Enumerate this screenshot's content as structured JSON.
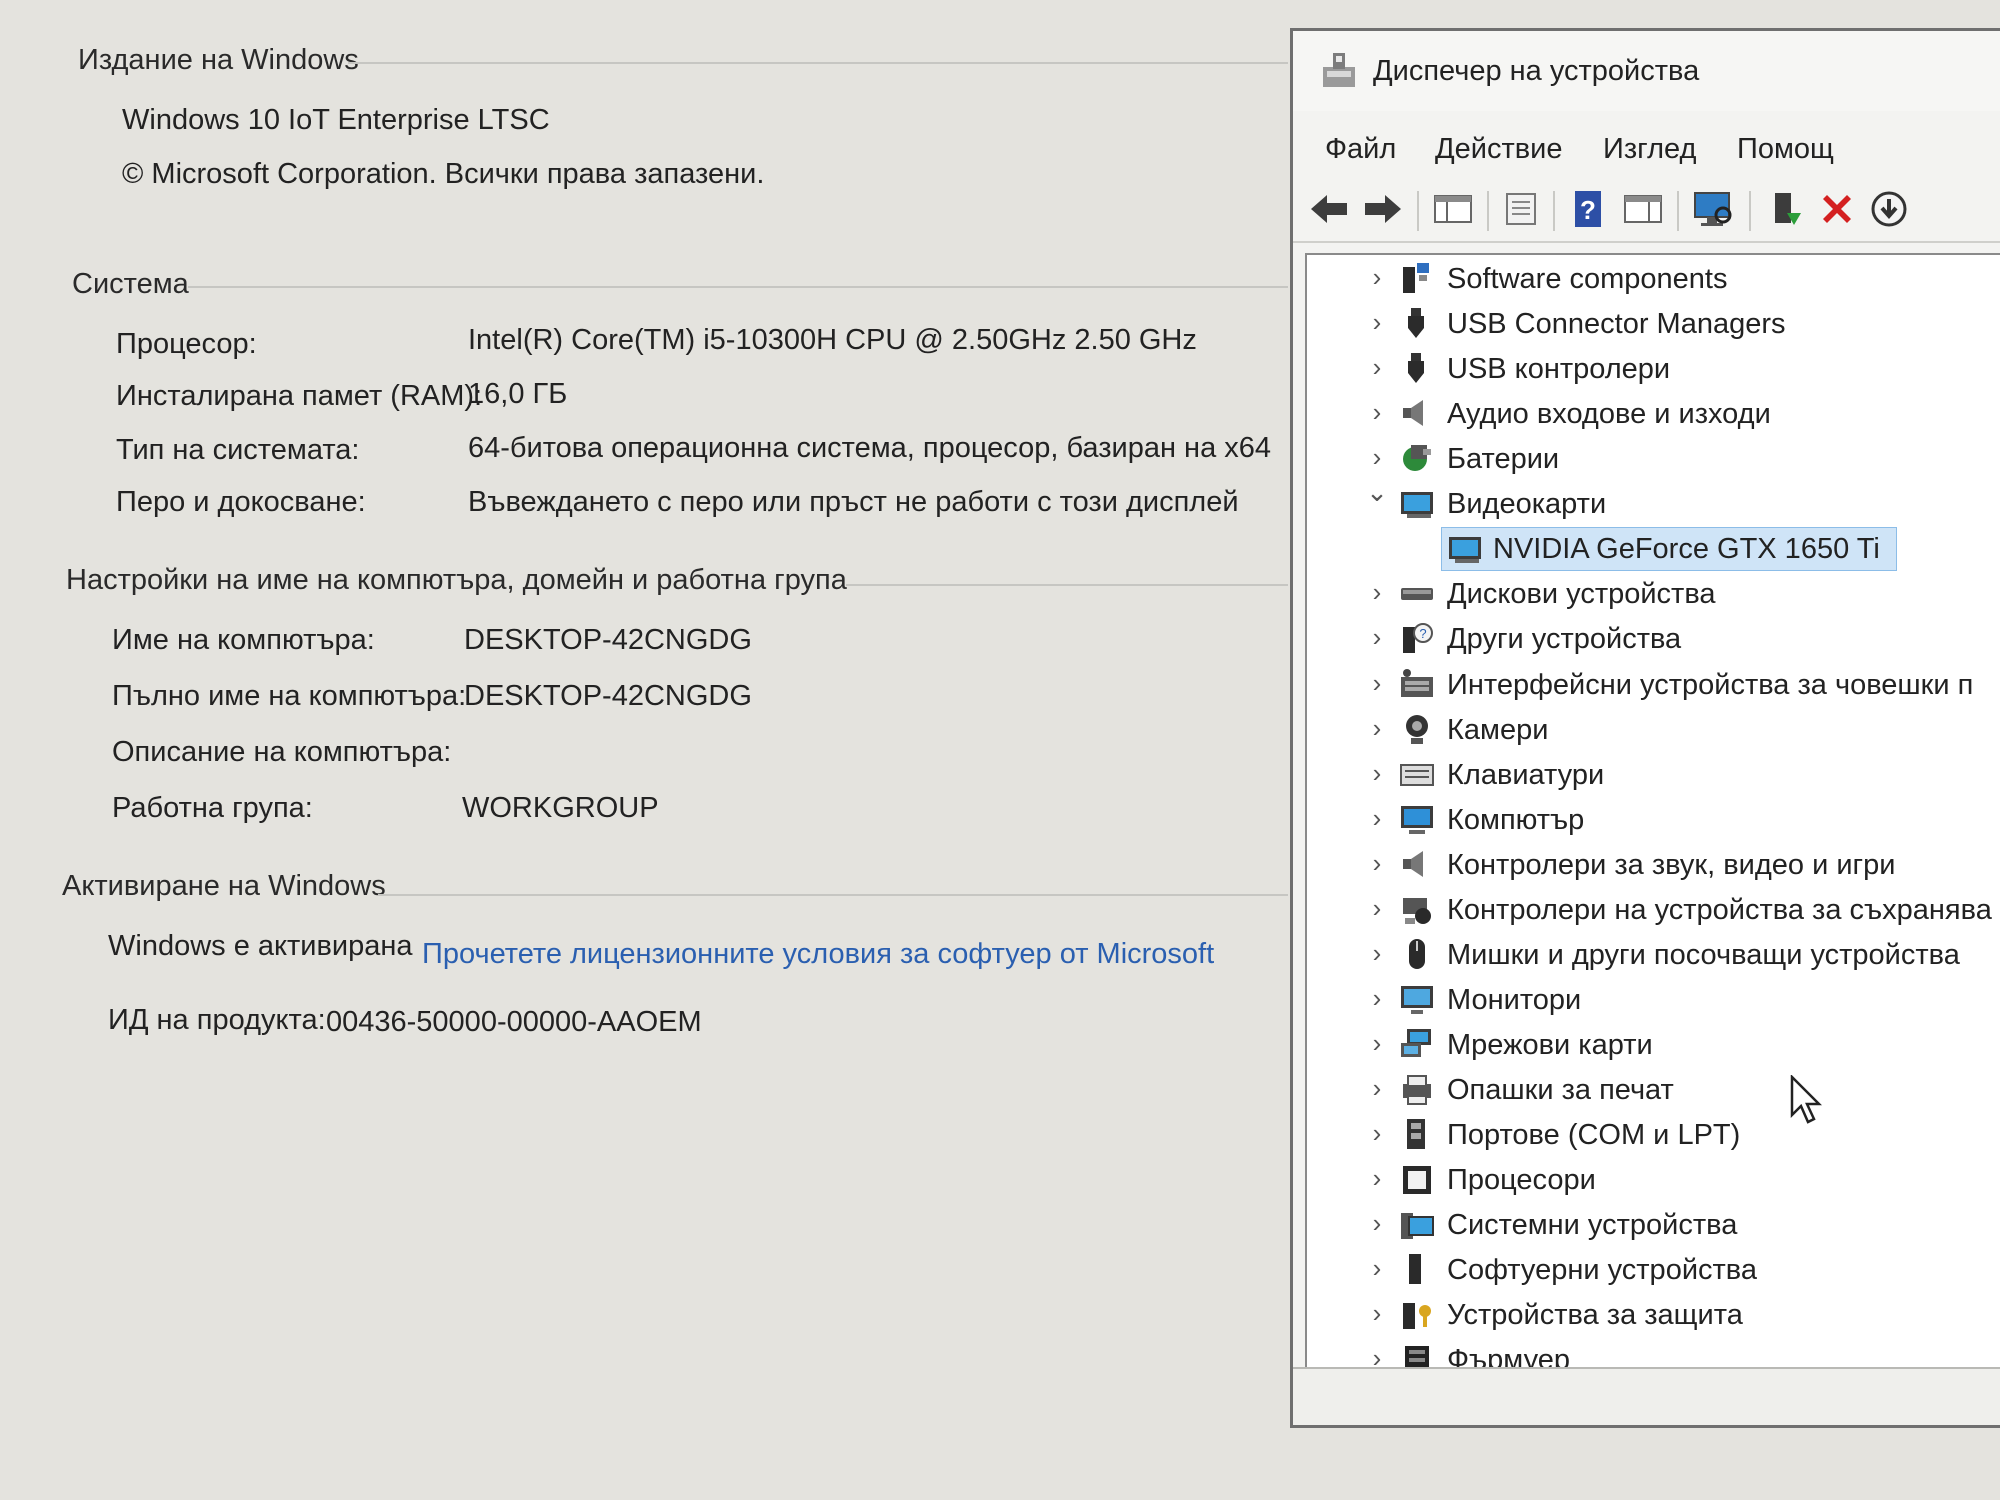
{
  "sysinfo": {
    "edition": {
      "heading": "Издание на Windows",
      "name": "Windows 10 IoT Enterprise LTSC",
      "copyright": "© Microsoft Corporation. Всички права запазени."
    },
    "system": {
      "heading": "Система",
      "rows": [
        {
          "label": "Процесор:",
          "value": "Intel(R) Core(TM) i5-10300H CPU @ 2.50GHz   2.50 GHz"
        },
        {
          "label": "Инсталирана памет (RAM):",
          "value": "16,0 ГБ"
        },
        {
          "label": "Тип на системата:",
          "value": "64-битова операционна система, процесор, базиран на x64"
        },
        {
          "label": "Перо и докосване:",
          "value": "Въвеждането с перо или пръст не работи с този дисплей"
        }
      ]
    },
    "computer": {
      "heading": "Настройки на име на компютъра, домейн и работна група",
      "rows": [
        {
          "label": "Име на компютъра:",
          "value": "DESKTOP-42CNGDG"
        },
        {
          "label": "Пълно име на компютъра:",
          "value": "DESKTOP-42CNGDG"
        },
        {
          "label": "Описание на компютъра:",
          "value": ""
        },
        {
          "label": "Работна група:",
          "value": "WORKGROUP"
        }
      ]
    },
    "activation": {
      "heading": "Активиране на Windows",
      "status": "Windows е активирана",
      "license_link": "Прочетете лицензионните условия за софтуер от Microsoft",
      "product_id_label": "ИД на продукта:",
      "product_id": "00436-50000-00000-AAOEM"
    }
  },
  "devmgr": {
    "title": "Диспечер на устройства",
    "menu": [
      "Файл",
      "Действие",
      "Изглед",
      "Помощ"
    ],
    "toolbar_icons": [
      "back-arrow-icon",
      "forward-arrow-icon",
      "show-hide-console-tree-icon",
      "properties-icon",
      "help-icon",
      "action-pane-icon",
      "scan-hardware-icon",
      "update-driver-icon",
      "uninstall-device-icon",
      "disable-device-icon"
    ],
    "tree": [
      {
        "label": "Software components",
        "icon": "software-component-icon",
        "expanded": false
      },
      {
        "label": "USB Connector Managers",
        "icon": "usb-icon",
        "expanded": false
      },
      {
        "label": "USB контролери",
        "icon": "usb-icon",
        "expanded": false
      },
      {
        "label": "Аудио входове и изходи",
        "icon": "speaker-icon",
        "expanded": false
      },
      {
        "label": "Батерии",
        "icon": "battery-icon",
        "expanded": false
      },
      {
        "label": "Видеокарти",
        "icon": "display-adapter-icon",
        "expanded": true,
        "children": [
          {
            "label": "NVIDIA GeForce GTX 1650 Ti",
            "icon": "display-adapter-icon",
            "selected": true
          }
        ]
      },
      {
        "label": "Дискови устройства",
        "icon": "disk-drive-icon",
        "expanded": false
      },
      {
        "label": "Други устройства",
        "icon": "unknown-device-icon",
        "expanded": false
      },
      {
        "label": "Интерфейсни устройства за човешки п",
        "icon": "hid-icon",
        "expanded": false
      },
      {
        "label": "Камери",
        "icon": "camera-icon",
        "expanded": false
      },
      {
        "label": "Клавиатури",
        "icon": "keyboard-icon",
        "expanded": false
      },
      {
        "label": "Компютър",
        "icon": "computer-icon",
        "expanded": false
      },
      {
        "label": "Контролери за звук, видео и игри",
        "icon": "speaker-icon",
        "expanded": false
      },
      {
        "label": "Контролери на устройства за съхранява",
        "icon": "storage-controller-icon",
        "expanded": false
      },
      {
        "label": "Мишки и други посочващи устройства",
        "icon": "mouse-icon",
        "expanded": false
      },
      {
        "label": "Монитори",
        "icon": "monitor-icon",
        "expanded": false
      },
      {
        "label": "Мрежови карти",
        "icon": "network-adapter-icon",
        "expanded": false
      },
      {
        "label": "Опашки за печат",
        "icon": "printer-icon",
        "expanded": false
      },
      {
        "label": "Портове (COM и LPT)",
        "icon": "port-icon",
        "expanded": false
      },
      {
        "label": "Процесори",
        "icon": "processor-icon",
        "expanded": false
      },
      {
        "label": "Системни устройства",
        "icon": "system-device-icon",
        "expanded": false
      },
      {
        "label": "Софтуерни устройства",
        "icon": "software-device-icon",
        "expanded": false
      },
      {
        "label": "Устройства за защита",
        "icon": "security-device-icon",
        "expanded": false
      },
      {
        "label": "Фърмуер",
        "icon": "firmware-icon",
        "expanded": false
      }
    ]
  },
  "colors": {
    "background": "#e4e3de",
    "link": "#2a5fb0",
    "selection": "#cfe4f7",
    "uninstall_red": "#d42020"
  }
}
